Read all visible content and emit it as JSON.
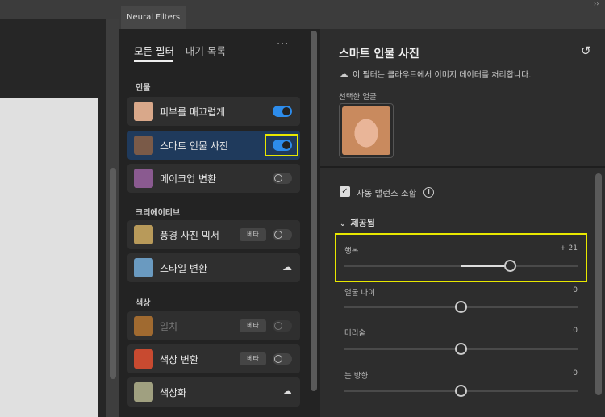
{
  "panel_tab": "Neural Filters",
  "list_tabs": {
    "all": "모든 필터",
    "waitlist": "대기 목록",
    "more": "···"
  },
  "categories": [
    {
      "title": "인물",
      "items": [
        {
          "label": "피부를 매끄럽게",
          "toggle": "on",
          "thumb": "#d9a88a"
        },
        {
          "label": "스마트 인물 사진",
          "toggle": "on",
          "selected": true,
          "thumb": "#7a5a48"
        },
        {
          "label": "메이크업 변환",
          "toggle": "off",
          "thumb": "#8a5a90"
        }
      ]
    },
    {
      "title": "크리에이티브",
      "items": [
        {
          "label": "풍경 사진 믹서",
          "badge": "베타",
          "toggle": "off",
          "thumb": "#b89a5a"
        },
        {
          "label": "스타일 변환",
          "cloud": "cloud-download-icon",
          "thumb": "#6a9ac0"
        }
      ]
    },
    {
      "title": "색상",
      "items": [
        {
          "label": "일치",
          "badge": "베타",
          "toggle": "off",
          "disabled": true,
          "thumb": "#a06a30"
        },
        {
          "label": "색상 변환",
          "badge": "베타",
          "toggle": "off",
          "thumb": "#c84a30"
        },
        {
          "label": "색상화",
          "cloud": "cloud-download-icon",
          "thumb": "#a0a080"
        }
      ]
    }
  ],
  "detail": {
    "title": "스마트 인물 사진",
    "cloud_note": "이 필터는 클라우드에서 이미지 데이터를 처리합니다.",
    "face_label": "선택한 얼굴",
    "auto_balance": "자동 밸런스 조합",
    "auto_balance_checked": true,
    "section": "제공됨",
    "sliders": [
      {
        "label": "행복",
        "value_text": "+ 21",
        "value": 21
      },
      {
        "label": "얼굴 나이",
        "value_text": "0",
        "value": 0
      },
      {
        "label": "머리숱",
        "value_text": "0",
        "value": 0
      },
      {
        "label": "눈 방향",
        "value_text": "0",
        "value": 0
      }
    ],
    "slider_range": [
      -50,
      50
    ]
  },
  "highlight_color": "#e8e800",
  "accent": "#2d8ceb"
}
